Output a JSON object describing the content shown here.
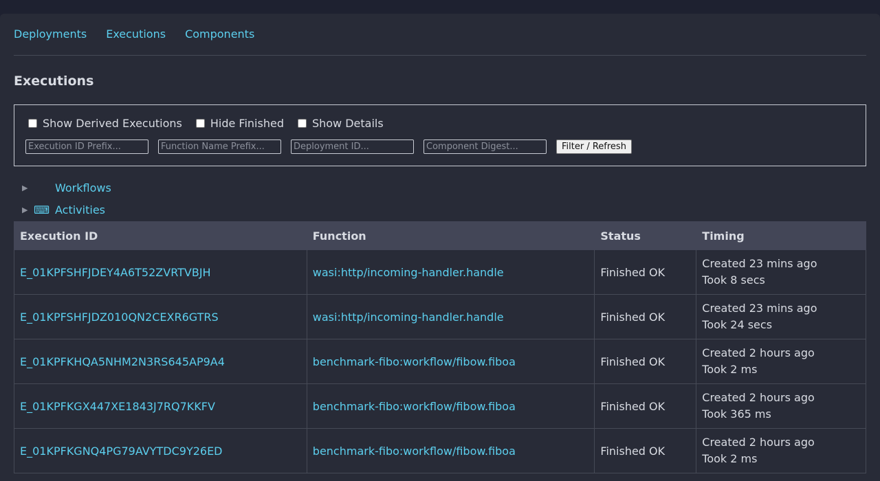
{
  "nav": {
    "items": [
      {
        "label": "Deployments"
      },
      {
        "label": "Executions"
      },
      {
        "label": "Components"
      }
    ]
  },
  "page": {
    "title": "Executions"
  },
  "filters": {
    "checkboxes": [
      {
        "label": "Show Derived Executions",
        "checked": false
      },
      {
        "label": "Hide Finished",
        "checked": false
      },
      {
        "label": "Show Details",
        "checked": false
      }
    ],
    "execution_id_placeholder": "Execution ID Prefix...",
    "function_name_placeholder": "Function Name Prefix...",
    "deployment_id_placeholder": "Deployment ID...",
    "component_digest_placeholder": "Component Digest...",
    "refresh_label": "Filter / Refresh"
  },
  "tree": {
    "workflows": {
      "icon": "workflow-icon",
      "glyph": "",
      "label": "Workflows"
    },
    "activities": {
      "icon": "keyboard-icon",
      "glyph": "⌨",
      "label": "Activities"
    }
  },
  "table": {
    "headers": [
      "Execution ID",
      "Function",
      "Status",
      "Timing"
    ],
    "rows": [
      {
        "id": "E_01KPFSHFJDEY4A6T52ZVRTVBJH",
        "function": "wasi:http/incoming-handler.handle",
        "status": "Finished OK",
        "created": "Created 23 mins ago",
        "took": "Took 8 secs"
      },
      {
        "id": "E_01KPFSHFJDZ010QN2CEXR6GTRS",
        "function": "wasi:http/incoming-handler.handle",
        "status": "Finished OK",
        "created": "Created 23 mins ago",
        "took": "Took 24 secs"
      },
      {
        "id": "E_01KPFKHQA5NHM2N3RS645AP9A4",
        "function": "benchmark-fibo:workflow/fibow.fiboa",
        "status": "Finished OK",
        "created": "Created 2 hours ago",
        "took": "Took 2 ms"
      },
      {
        "id": "E_01KPFKGX447XE1843J7RQ7KKFV",
        "function": "benchmark-fibo:workflow/fibow.fiboa",
        "status": "Finished OK",
        "created": "Created 2 hours ago",
        "took": "Took 365 ms"
      },
      {
        "id": "E_01KPFKGNQ4PG79AVYTDC9Y26ED",
        "function": "benchmark-fibo:workflow/fibow.fiboa",
        "status": "Finished OK",
        "created": "Created 2 hours ago",
        "took": "Took 2 ms"
      }
    ]
  },
  "colors": {
    "accent": "#5ccfee",
    "background": "#282b37",
    "header_bg": "#434657"
  }
}
